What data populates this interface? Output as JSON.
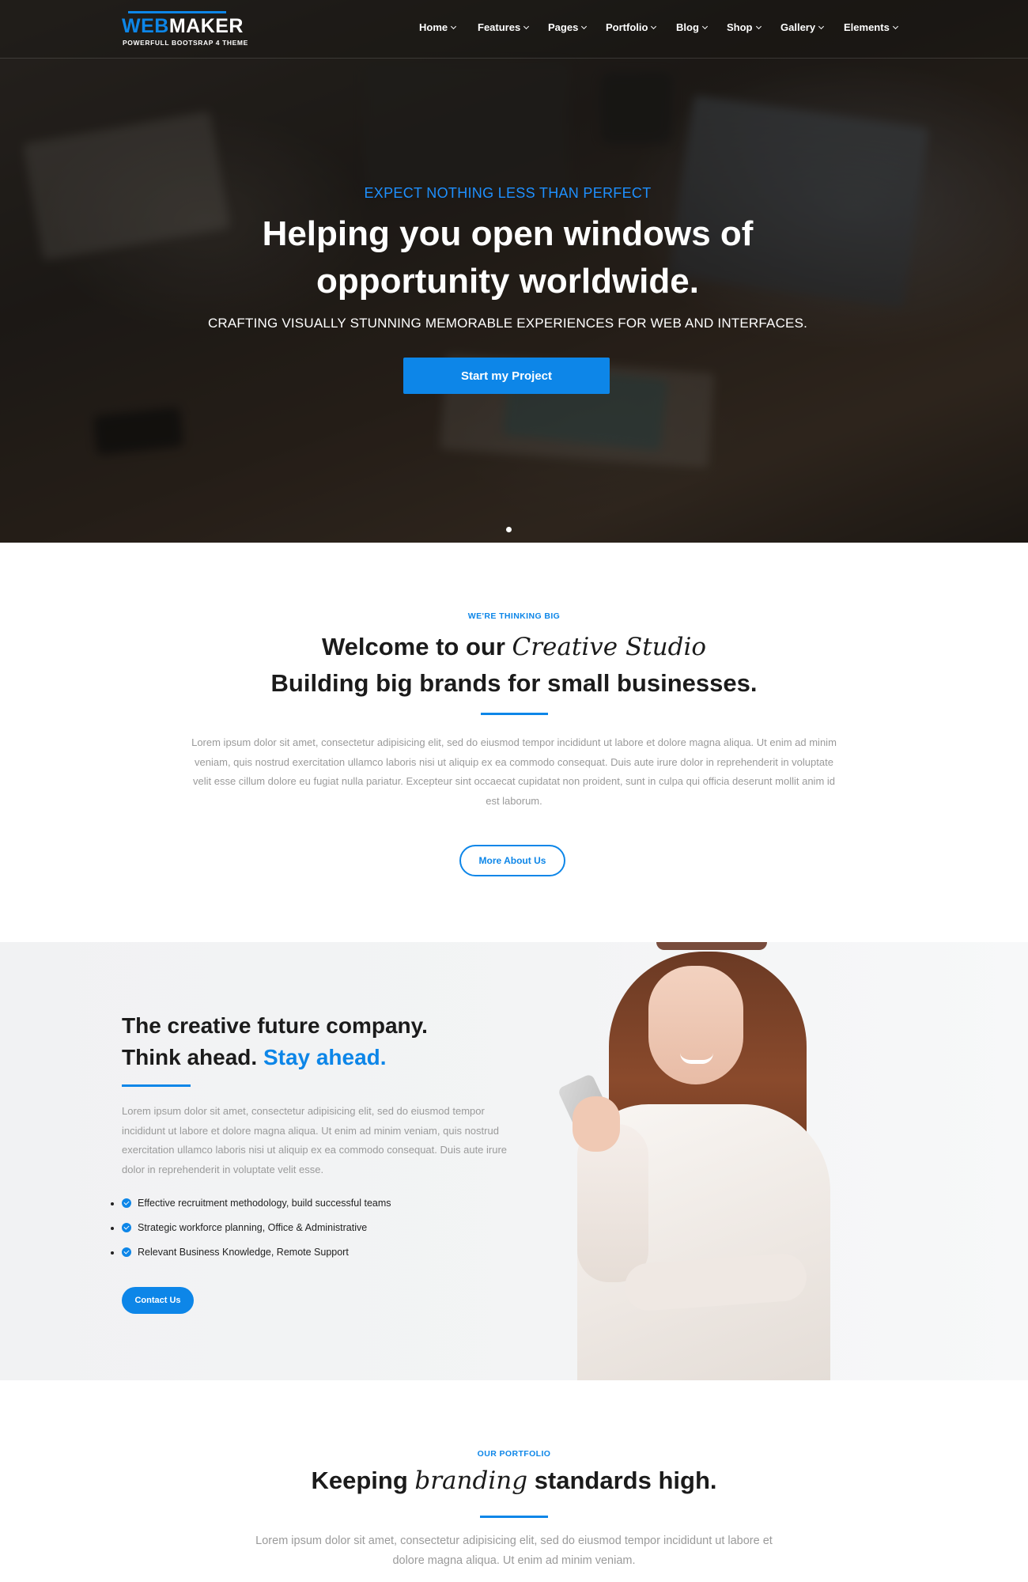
{
  "brand": {
    "logo_part1": "WEB",
    "logo_part2": "MAKER",
    "tagline": "POWERFULL BOOTSRAP 4 THEME",
    "accent_color": "#0d86e8"
  },
  "nav": {
    "items": [
      {
        "label": "Home"
      },
      {
        "label": "Features"
      },
      {
        "label": "Pages"
      },
      {
        "label": "Portfolio"
      },
      {
        "label": "Blog"
      },
      {
        "label": "Shop"
      },
      {
        "label": "Gallery"
      },
      {
        "label": "Elements"
      }
    ],
    "dropdown_icon": "chevron-down-icon"
  },
  "hero": {
    "eyebrow": "EXPECT NOTHING LESS THAN PERFECT",
    "title_line1": "Helping you open windows of",
    "title_line2": "opportunity worldwide.",
    "subtitle": "CRAFTING VISUALLY STUNNING MEMORABLE EXPERIENCES FOR WEB AND INTERFACES.",
    "cta_label": "Start my Project"
  },
  "welcome": {
    "eyebrow": "WE'RE THINKING BIG",
    "title_plain": "Welcome to our ",
    "title_script": "Creative Studio",
    "title_line2": "Building big brands for small businesses.",
    "paragraph": "Lorem ipsum dolor sit amet, consectetur adipisicing elit, sed do eiusmod tempor incididunt ut labore et dolore magna aliqua. Ut enim ad minim veniam, quis nostrud exercitation ullamco laboris nisi ut aliquip ex ea commodo consequat. Duis aute irure dolor in reprehenderit in voluptate velit esse cillum dolore eu fugiat nulla pariatur. Excepteur sint occaecat cupidatat non proident, sunt in culpa qui officia deserunt mollit anim id est laborum.",
    "button_label": "More About Us"
  },
  "future": {
    "title_line1": "The creative future company.",
    "title_line2_plain": "Think ahead. ",
    "title_line2_blue": "Stay ahead.",
    "paragraph": "Lorem ipsum dolor sit amet, consectetur adipisicing elit, sed do eiusmod tempor incididunt ut labore et dolore magna aliqua. Ut enim ad minim veniam, quis nostrud exercitation ullamco laboris nisi ut aliquip ex ea commodo consequat. Duis aute irure dolor in reprehenderit in voluptate velit esse.",
    "checklist": [
      "Effective recruitment methodology, build successful teams",
      "Strategic workforce planning, Office & Administrative",
      "Relevant Business Knowledge, Remote Support"
    ],
    "button_label": "Contact Us"
  },
  "portfolio": {
    "eyebrow": "OUR PORTFOLIO",
    "title_plain1": "Keeping ",
    "title_script": "branding",
    "title_plain2": " standards high.",
    "paragraph": "Lorem ipsum dolor sit amet, consectetur adipisicing elit, sed do eiusmod tempor incididunt ut labore et dolore magna aliqua. Ut enim ad minim veniam."
  }
}
